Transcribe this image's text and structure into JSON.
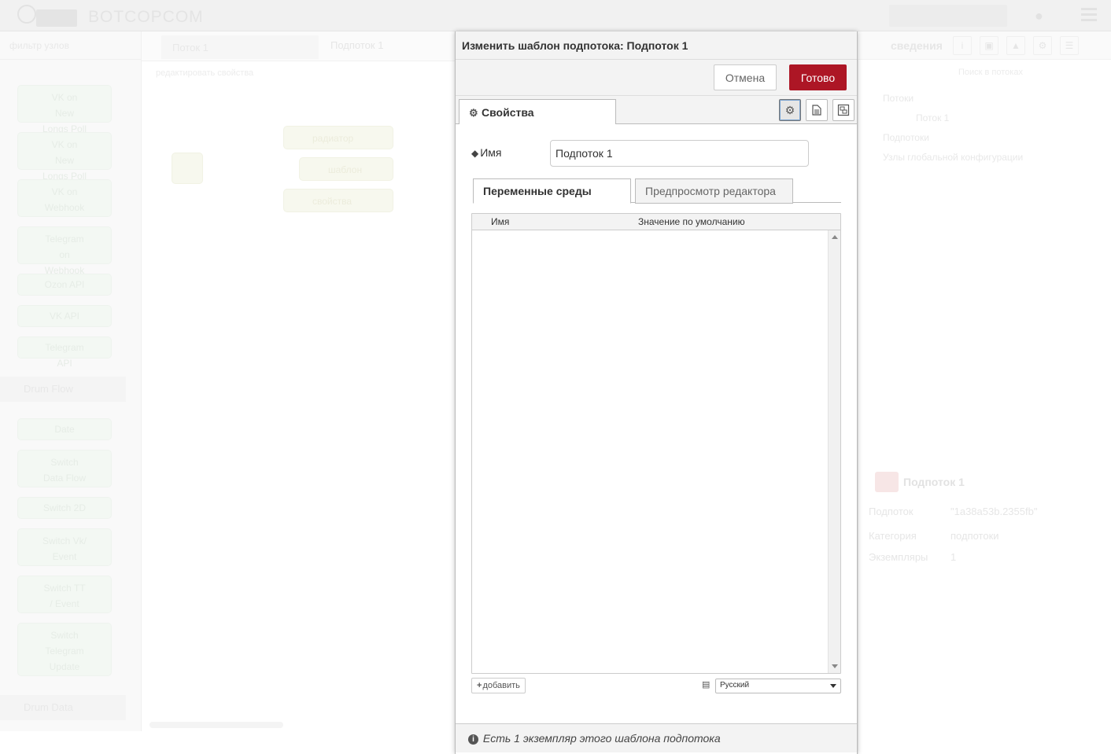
{
  "tray": {
    "title": "Изменить шаблон подпотока: Подпоток 1",
    "cancel_label": "Отмена",
    "done_label": "Готово",
    "tab_properties": "Свойства",
    "name_label": "Имя",
    "name_value": "Подпоток 1",
    "subtabs": [
      "Переменные среды",
      "Предпросмотр редактора"
    ],
    "env_columns": [
      "Имя",
      "Значение по умолчанию"
    ],
    "add_label": "добавить",
    "language_selected": "Русский",
    "footer_text": "Есть 1 экземпляр этого шаблона подпотока"
  },
  "background": {
    "brand": "BOTCOPCOM",
    "palette_search": "фильтр узлов",
    "palette_nodes": [
      "VK on New Longs Poll",
      "VK on New Longs Poll",
      "VK on Webhook",
      "Telegram on Webhook",
      "Ozon API",
      "VK API",
      "Telegram API"
    ],
    "palette_category_1": "Drum Flow",
    "palette_nodes_2": [
      "Date",
      "Switch Data Flow",
      "Switch 2D",
      "Switch Vk/ Event",
      "Switch TT / Event",
      "Switch Telegram Update"
    ],
    "palette_category_2": "Drum Data",
    "flow_tab": "Поток 1",
    "subflow_tab": "Подпоток 1",
    "toolbar_text": "редактировать свойства",
    "workspace_nodes": [
      "радиатор",
      "шаблон",
      "свойства"
    ],
    "sidebar_title": "сведения",
    "sidebar_search": "Поиск в потоках",
    "sidebar_tree": [
      "Потоки",
      "Поток 1",
      "Подпотоки",
      "Узлы глобальной конфигурации"
    ],
    "sidebar_info_title": "Подпоток 1",
    "sidebar_rows": [
      {
        "key": "Подпоток",
        "value": "\"1a38a53b.2355fb\""
      },
      {
        "key": "Категория",
        "value": "подпотоки"
      },
      {
        "key": "Экземпляры",
        "value": "1"
      }
    ]
  },
  "colors": {
    "accent": "#ad1625",
    "header_bg": "#f3f3f3"
  },
  "icons": {
    "properties": "gear-icon",
    "description": "file-text-icon",
    "appearance": "object-group-icon",
    "name": "tag-icon",
    "add": "plus-icon",
    "language": "language-icon",
    "footer": "info-circle-icon"
  }
}
